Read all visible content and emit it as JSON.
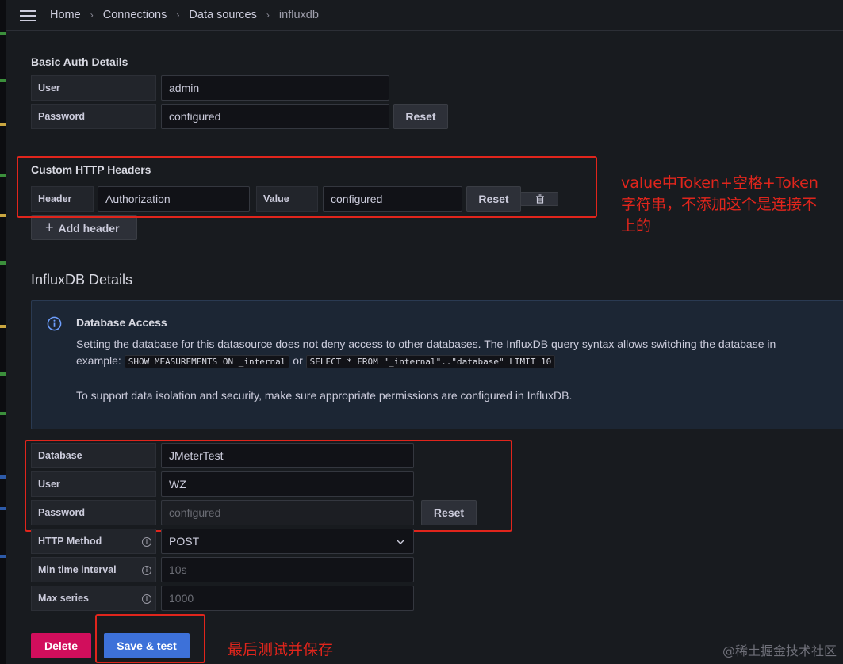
{
  "breadcrumb": {
    "items": [
      "Home",
      "Connections",
      "Data sources",
      "influxdb"
    ],
    "separator": "›"
  },
  "basic_auth": {
    "title": "Basic Auth Details",
    "user_label": "User",
    "user_value": "admin",
    "password_label": "Password",
    "password_value": "configured",
    "reset_label": "Reset"
  },
  "custom_headers": {
    "title": "Custom HTTP Headers",
    "header_label": "Header",
    "header_value": "Authorization",
    "value_label": "Value",
    "value_value": "configured",
    "reset_label": "Reset",
    "add_header_label": "Add header"
  },
  "annotation_top": {
    "line1": "value中Token+空格+Token",
    "line2": "字符串，不添加这个是连接不",
    "line3": "上的"
  },
  "influx": {
    "title": "InfluxDB Details",
    "alert_title": "Database Access",
    "alert_line1": "Setting the database for this datasource does not deny access to other databases. The InfluxDB query syntax allows switching the database in",
    "alert_line2_prefix": "example:",
    "code1": "SHOW MEASUREMENTS ON _internal",
    "alert_or": "or",
    "code2": "SELECT * FROM \"_internal\"..\"database\" LIMIT 10",
    "alert_line3": "To support data isolation and security, make sure appropriate permissions are configured in InfluxDB.",
    "database_label": "Database",
    "database_value": "JMeterTest",
    "user_label": "User",
    "user_value": "WZ",
    "password_label": "Password",
    "password_value": "configured",
    "reset_label": "Reset",
    "http_method_label": "HTTP Method",
    "http_method_value": "POST",
    "min_interval_label": "Min time interval",
    "min_interval_placeholder": "10s",
    "max_series_label": "Max series",
    "max_series_placeholder": "1000"
  },
  "actions": {
    "delete_label": "Delete",
    "save_label": "Save & test"
  },
  "annotation_bottom": "最后测试并保存",
  "watermark": "@稀土掘金技术社区",
  "colors": {
    "annotation": "#e0251c",
    "primary": "#3d71d9",
    "danger": "#d10e5c"
  }
}
